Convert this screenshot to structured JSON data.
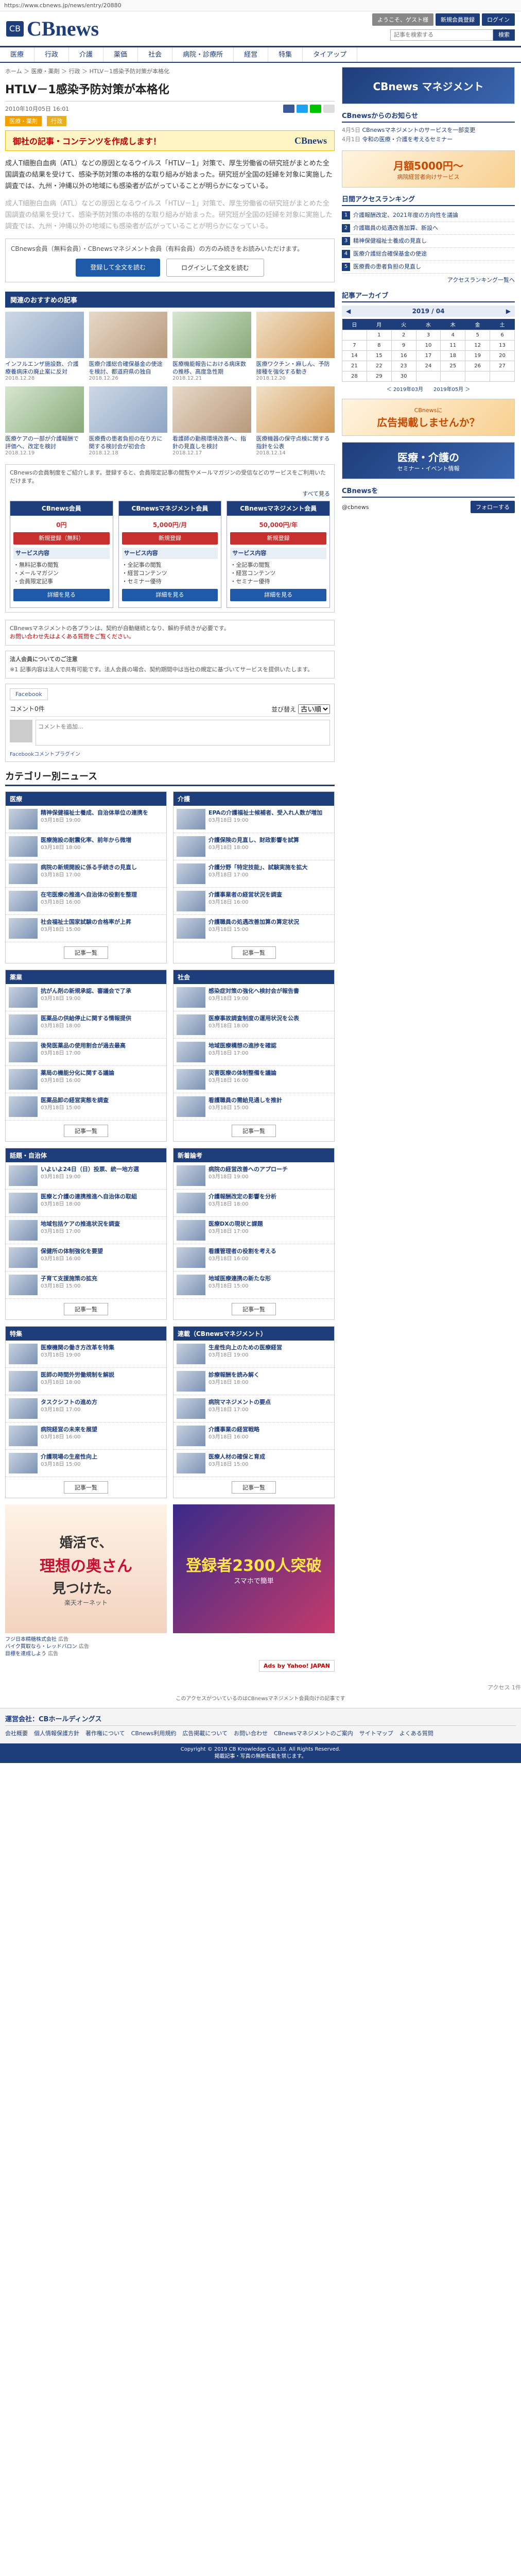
{
  "topbar": {
    "url": "https://www.cbnews.jp/news/entry/20880"
  },
  "header": {
    "logo": "CBnews",
    "logo_mark": "CB",
    "btn_register": "ようこそ、ゲスト様",
    "btn_login": "新規会員登録",
    "btn_logout": "ログイン",
    "search_placeholder": "記事を検索する",
    "search_button": "検索"
  },
  "nav": [
    "医療",
    "行政",
    "介護",
    "薬価",
    "社会",
    "病院・診療所",
    "経営",
    "特集",
    "タイアップ"
  ],
  "breadcrumb": "ホーム ＞ 医療・薬剤 ＞ 行政 ＞ HTLV－1感染予防対策が本格化",
  "article": {
    "title": "HTLV－1感染予防対策が本格化",
    "date": "2010年10月05日 16:01",
    "tag_1": "医療・薬剤",
    "tag_2": "行政",
    "banner_text": "御社の記事・コンテンツを作成します！",
    "banner_logo": "CBnews",
    "p1": "成人T細胞白血病（ATL）などの原因となるウイルス「HTLV－1」対策で、厚生労働省の研究班がまとめた全国調査の結果を受けて、感染予防対策の本格的な取り組みが始まった。研究班が全国の妊婦を対象に実施した調査では、九州・沖縄以外の地域にも感染者が広がっていることが明らかになっている。",
    "p2": "成人T細胞白血病（ATL）などの原因となるウイルス「HTLV－1」対策で、厚生労働省の研究班がまとめた全国調査の結果を受けて、感染予防対策の本格的な取り組みが始まった。研究班が全国の妊婦を対象に実施した調査では、九州・沖縄以外の地域にも感染者が広がっていることが明らかになっている。",
    "notice": "CBnews会員（無料会員）・CBnewsマネジメント会員（有料会員）の方のみ続きをお読みいただけます。",
    "btn_register": "登録して全文を読む",
    "btn_login": "ログインして全文を読む"
  },
  "reco": {
    "title": "関連のおすすめの記事",
    "items": [
      {
        "title": "インフルエンザ施設数、介護療養病床の廃止案に反対",
        "date": "2018.12.28"
      },
      {
        "title": "医療介護総合確保基金の使途を検討、都道府県の独自",
        "date": "2018.12.26"
      },
      {
        "title": "医療機能報告における病床数の推移、高度急性期",
        "date": "2018.12.21"
      },
      {
        "title": "医療ワクチン・麻しん、予防接種を強化する動き",
        "date": "2018.12.20"
      },
      {
        "title": "医療ケアの一部が介護報酬で評価へ、改定を検討",
        "date": "2018.12.19"
      },
      {
        "title": "医療費の患者負担の在り方に関する検討会が初会合",
        "date": "2018.12.18"
      },
      {
        "title": "看護師の勤務環境改善へ、指針の見直しを検討",
        "date": "2018.12.17"
      },
      {
        "title": "医療機器の保守点検に関する指針を公表",
        "date": "2018.12.14"
      }
    ]
  },
  "members": {
    "intro": "CBnewsの会員制度をご紹介します。登録すると、会員限定記事の閲覧やメールマガジンの受信などのサービスをご利用いただけます。",
    "all_link": "すべて見る",
    "plans": [
      {
        "name": "CBnews会員",
        "sub": "無料",
        "price": "0円",
        "btn": "新規登録（無料）",
        "section": "サービス内容",
        "features": "・無料記事の閲覧\n・メールマガジン\n・会員限定記事"
      },
      {
        "name": "CBnewsマネジメント会員",
        "sub": "月額",
        "price": "5,000円/月",
        "btn": "新規登録",
        "section": "サービス内容",
        "features": "・全記事の閲覧\n・経営コンテンツ\n・セミナー優待"
      },
      {
        "name": "CBnewsマネジメント会員",
        "sub": "年額",
        "price": "50,000円/年",
        "btn": "新規登録",
        "section": "サービス内容",
        "features": "・全記事の閲覧\n・経営コンテンツ\n・セミナー優待"
      }
    ],
    "plan_buttons": [
      "詳細を見る",
      "詳細を見る",
      "詳細を見る"
    ]
  },
  "info": {
    "text1": "CBnewsマネジメントの各プランは、契約が自動継続となり、解約手続きが必要です。",
    "text2": "お問い合わせ先はよくある質問をご覧ください。",
    "head": "法人会員についてのご注意",
    "text3": "※1 記事内容は法人で共有可能です。法人会員の場合、契約期間中は当社の規定に基づいてサービスを提供いたします。"
  },
  "comments": {
    "fb_tab": "Facebook",
    "count_label": "コメント0件",
    "sort_label": "並び替え",
    "sort_value": "古い順",
    "placeholder": "コメントを追加...",
    "plugin": "Facebookコメントプラグイン"
  },
  "categories": {
    "title": "カテゴリー別ニュース",
    "blocks": [
      {
        "head": "医療",
        "items": [
          {
            "t": "精神保健福祉士養成、自治体単位の連携を",
            "d": "03月18日 19:00"
          },
          {
            "t": "医療施設の耐震化率、前年から微増",
            "d": "03月18日 18:00"
          },
          {
            "t": "病院の新規開設に係る手続きの見直し",
            "d": "03月18日 17:00"
          },
          {
            "t": "在宅医療の推進へ自治体の役割を整理",
            "d": "03月18日 16:00"
          },
          {
            "t": "社会福祉士国家試験の合格率が上昇",
            "d": "03月18日 15:00"
          }
        ],
        "more": "記事一覧"
      },
      {
        "head": "介護",
        "items": [
          {
            "t": "EPAの介護福祉士候補者、受入れ人数が増加",
            "d": "03月18日 19:00"
          },
          {
            "t": "介護保険の見直し、財政影響を試算",
            "d": "03月18日 18:00"
          },
          {
            "t": "介護分野「特定技能」、試験実施を拡大",
            "d": "03月18日 17:00"
          },
          {
            "t": "介護事業者の経営状況を調査",
            "d": "03月18日 16:00"
          },
          {
            "t": "介護職員の処遇改善加算の算定状況",
            "d": "03月18日 15:00"
          }
        ],
        "more": "記事一覧"
      },
      {
        "head": "薬業",
        "items": [
          {
            "t": "抗がん剤の新規承認、審議会で了承",
            "d": "03月18日 19:00"
          },
          {
            "t": "医薬品の供給停止に関する情報提供",
            "d": "03月18日 18:00"
          },
          {
            "t": "後発医薬品の使用割合が過去最高",
            "d": "03月18日 17:00"
          },
          {
            "t": "薬局の機能分化に関する議論",
            "d": "03月18日 16:00"
          },
          {
            "t": "医薬品卸の経営実態を調査",
            "d": "03月18日 15:00"
          }
        ],
        "more": "記事一覧"
      },
      {
        "head": "社会",
        "items": [
          {
            "t": "感染症対策の強化へ検討会が報告書",
            "d": "03月18日 19:00"
          },
          {
            "t": "医療事故調査制度の運用状況を公表",
            "d": "03月18日 18:00"
          },
          {
            "t": "地域医療構想の進捗を確認",
            "d": "03月18日 17:00"
          },
          {
            "t": "災害医療の体制整備を議論",
            "d": "03月18日 16:00"
          },
          {
            "t": "看護職員の需給見通しを推計",
            "d": "03月18日 15:00"
          }
        ],
        "more": "記事一覧"
      },
      {
        "head": "話題・自治体",
        "items": [
          {
            "t": "いよいよ24日（日）投票、統一地方選",
            "d": "03月18日 19:00"
          },
          {
            "t": "医療と介護の連携推進へ自治体の取組",
            "d": "03月18日 18:00"
          },
          {
            "t": "地域包括ケアの推進状況を調査",
            "d": "03月18日 17:00"
          },
          {
            "t": "保健所の体制強化を要望",
            "d": "03月18日 16:00"
          },
          {
            "t": "子育て支援施策の拡充",
            "d": "03月18日 15:00"
          }
        ],
        "more": "記事一覧"
      },
      {
        "head": "新着論考",
        "items": [
          {
            "t": "病院の経営改善へのアプローチ",
            "d": "03月18日 19:00"
          },
          {
            "t": "介護報酬改定の影響を分析",
            "d": "03月18日 18:00"
          },
          {
            "t": "医療DXの現状と課題",
            "d": "03月18日 17:00"
          },
          {
            "t": "看護管理者の役割を考える",
            "d": "03月18日 16:00"
          },
          {
            "t": "地域医療連携の新たな形",
            "d": "03月18日 15:00"
          }
        ],
        "more": "記事一覧"
      },
      {
        "head": "特集",
        "items": [
          {
            "t": "医療機関の働き方改革を特集",
            "d": "03月18日 19:00"
          },
          {
            "t": "医師の時間外労働規制を解説",
            "d": "03月18日 18:00"
          },
          {
            "t": "タスクシフトの進め方",
            "d": "03月18日 17:00"
          },
          {
            "t": "病院経営の未来を展望",
            "d": "03月18日 16:00"
          },
          {
            "t": "介護現場の生産性向上",
            "d": "03月18日 15:00"
          }
        ],
        "more": "記事一覧"
      },
      {
        "head": "連載（CBnewsマネジメント）",
        "items": [
          {
            "t": "生産性向上のための医療経営",
            "d": "03月18日 19:00"
          },
          {
            "t": "診療報酬を読み解く",
            "d": "03月18日 18:00"
          },
          {
            "t": "病院マネジメントの要点",
            "d": "03月18日 17:00"
          },
          {
            "t": "介護事業の経営戦略",
            "d": "03月18日 16:00"
          },
          {
            "t": "医療人材の確保と育成",
            "d": "03月18日 15:00"
          }
        ],
        "more": "記事一覧"
      }
    ]
  },
  "ads": {
    "note": "このアクセスがついているのはCBnewsマネジメント会員向けの記事です",
    "ad1_line1": "婚活で、",
    "ad1_line2": "理想の奥さん",
    "ad1_line3": "見つけた。",
    "ad1_sub": "楽天オーネット",
    "ad2_line1": "登録者2300人突破",
    "ad2_sub": "スマホで簡単",
    "cap1_title": "フジ日本精糖株式会社",
    "cap1_text": "広告",
    "cap2_title": "バイク買取なら・レッドバロン",
    "cap2_text": "広告",
    "cap3_title": "目標を達成しよう",
    "cap3_text": "広告",
    "yahoo": "Ads by Yahoo! JAPAN"
  },
  "footer": {
    "head": "運営会社：CBホールディングス",
    "links": [
      "会社概要",
      "個人情報保護方針",
      "著作権について",
      "CBnews利用規約",
      "広告掲載について",
      "お問い合わせ",
      "CBnewsマネジメントのご案内",
      "サイトマップ",
      "よくある質問"
    ],
    "copyright": "Copyright © 2019 CB Knowledge Co.,Ltd. All Rights Reserved.",
    "copyright2": "掲載記事・写真の無断転載を禁じます。"
  },
  "side": {
    "banner_top": "CBnews マネジメント",
    "notice_head": "CBnewsからのお知らせ",
    "notice_list": [
      {
        "d": "4月5日",
        "t": "CBnewsマネジメントのサービスを一部変更"
      },
      {
        "d": "4月1日",
        "t": "令和の医療・介護を考えるセミナー"
      }
    ],
    "banner_mid": "月額5000円〜",
    "banner_mid_sub": "病院経営者向けサービス",
    "rank_head": "日間アクセスランキング",
    "rank": [
      "介護報酬改定、2021年度の方向性を議論",
      "介護職員の処遇改善加算、新設へ",
      "精神保健福祉士養成の見直し",
      "医療介護総合確保基金の使途",
      "医療費の患者負担の見直し"
    ],
    "rank_more": "アクセスランキング一覧へ",
    "cal_head": "記事アーカイブ",
    "cal_month": "2019 / 04",
    "cal_days": [
      "日",
      "月",
      "火",
      "水",
      "木",
      "金",
      "土"
    ],
    "cal_rows": [
      [
        "",
        "1",
        "2",
        "3",
        "4",
        "5",
        "6"
      ],
      [
        "7",
        "8",
        "9",
        "10",
        "11",
        "12",
        "13"
      ],
      [
        "14",
        "15",
        "16",
        "17",
        "18",
        "19",
        "20"
      ],
      [
        "21",
        "22",
        "23",
        "24",
        "25",
        "26",
        "27"
      ],
      [
        "28",
        "29",
        "30",
        "",
        "",
        "",
        ""
      ]
    ],
    "cal_nav": "＜ 2019年03月　　2019年05月 ＞",
    "banner_ad": "広告掲載しませんか？",
    "banner_ad_sub": "CBnewsに",
    "event_head": "医療・介護の",
    "event_sub": "セミナー・イベント情報",
    "twitter_head": "CBnewsを",
    "twitter_sub": "@cbnews",
    "follow": "フォローする"
  },
  "access_note": "アクセス 1件"
}
